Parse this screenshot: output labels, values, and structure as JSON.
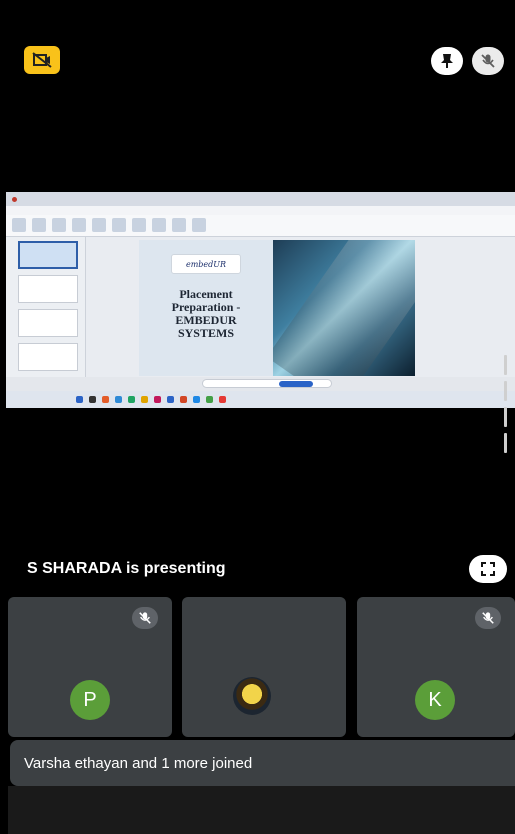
{
  "presentation": {
    "presenter_text": "S SHARADA is presenting",
    "slide": {
      "logo_text": "embedUR",
      "title_lines": [
        "Placement",
        "Preparation -",
        "EMBEDUR",
        "SYSTEMS"
      ]
    }
  },
  "participants": [
    {
      "initial": "P",
      "avatar_color": "#5b9e39",
      "muted": true
    },
    {
      "initial": "",
      "photo": true,
      "muted": false
    },
    {
      "initial": "K",
      "avatar_color": "#5b9e39",
      "muted": true
    }
  ],
  "notification": {
    "text": "Varsha ethayan and 1 more joined"
  },
  "colors": {
    "camera_off_bg": "#f9c21a",
    "tile_bg": "#3c4043",
    "avatar_green": "#5b9e39"
  },
  "icons": {
    "camera_off": "camera-off-icon",
    "pin": "pin-icon",
    "mic_off": "mic-off-icon",
    "fullscreen": "fullscreen-icon"
  }
}
